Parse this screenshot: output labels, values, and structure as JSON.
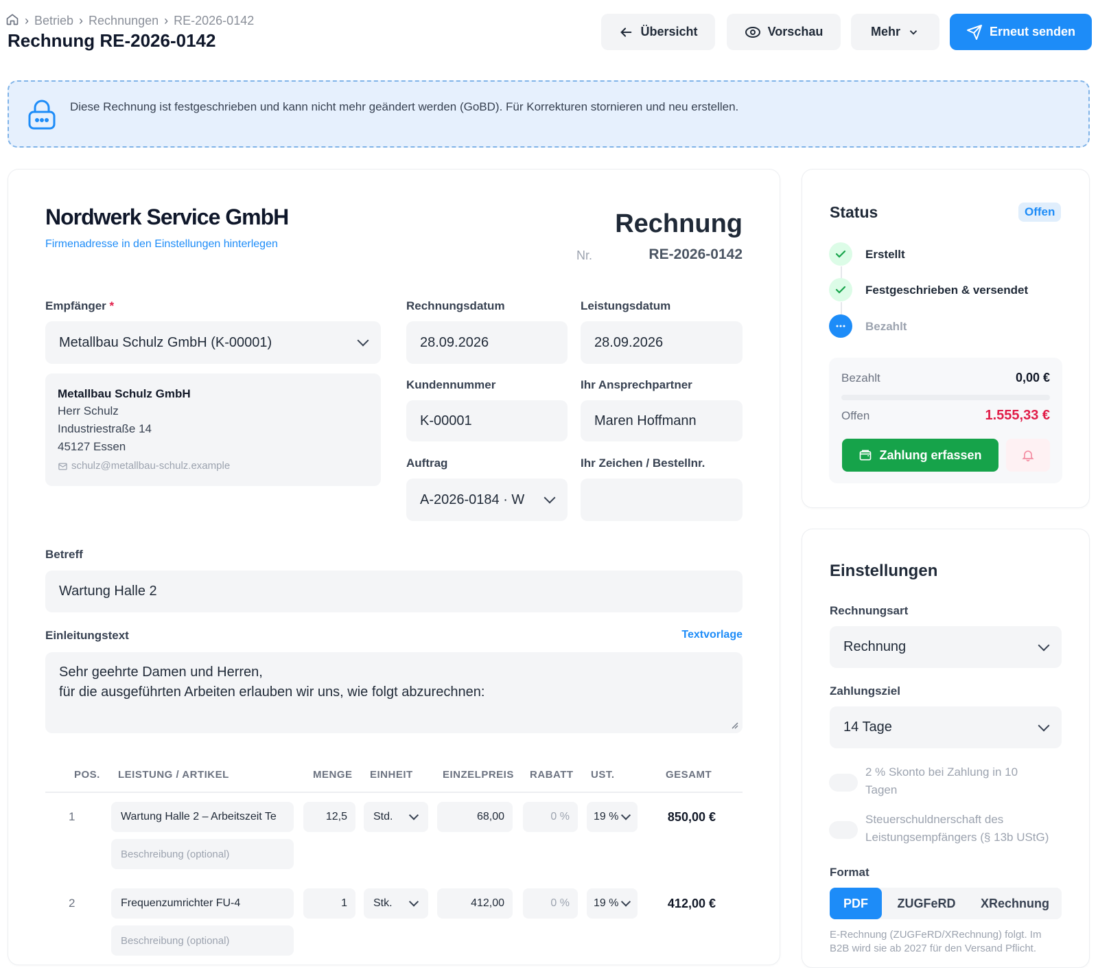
{
  "breadcrumb": {
    "items": [
      "Betrieb",
      "Rechnungen",
      "RE-2026-0142"
    ]
  },
  "page_title": "Rechnung RE-2026-0142",
  "toolbar": {
    "overview_label": "Übersicht",
    "preview_label": "Vorschau",
    "more_label": "Mehr",
    "resend_label": "Erneut senden"
  },
  "notice": {
    "text": "Diese Rechnung ist festgeschrieben und kann nicht mehr geändert werden (GoBD). Für Korrekturen stornieren und neu erstellen."
  },
  "doc": {
    "company": "Nordwerk Service GmbH",
    "company_link": "Firmenadresse in den Einstellungen hinterlegen",
    "doc_type": "Rechnung",
    "nr_label": "Nr.",
    "nr": "RE-2026-0142",
    "recipient_label": "Empfänger",
    "required": "*",
    "recipient": "Metallbau Schulz GmbH (K-00001)",
    "address": {
      "name": "Metallbau Schulz GmbH",
      "contact": "Herr Schulz",
      "street": "Industriestraße 14",
      "city": "45127 Essen",
      "email": "schulz@metallbau-schulz.example"
    },
    "invoice_date_label": "Rechnungsdatum",
    "invoice_date": "28.09.2026",
    "service_date_label": "Leistungsdatum",
    "service_date": "28.09.2026",
    "customer_no_label": "Kundennummer",
    "customer_no": "K-00001",
    "contact_label": "Ihr Ansprechpartner",
    "contact": "Maren Hoffmann",
    "order_label": "Auftrag",
    "order": "A-2026-0184 · W",
    "ref_label": "Ihr Zeichen / Bestellnr.",
    "ref": "",
    "subject_label": "Betreff",
    "subject": "Wartung Halle 2",
    "intro_label": "Einleitungstext",
    "intro_template": "Textvorlage",
    "intro_line1": "Sehr geehrte Damen und Herren,",
    "intro_line2": "für die ausgeführten Arbeiten erlauben wir uns, wie folgt abzurechnen:"
  },
  "table": {
    "headers": [
      "POS.",
      "LEISTUNG / ARTIKEL",
      "MENGE",
      "EINHEIT",
      "EINZELPREIS",
      "RABATT",
      "UST.",
      "GESAMT"
    ],
    "rows": [
      {
        "pos": "1",
        "item": "Wartung Halle 2 – Arbeitszeit Te",
        "desc": "Beschreibung (optional)",
        "qty": "12,5",
        "unit": "Std.",
        "price": "68,00",
        "discount": "0 %",
        "vat": "19 %",
        "total": "850,00 €"
      },
      {
        "pos": "2",
        "item": "Frequenzumrichter FU-4",
        "desc": "Beschreibung (optional)",
        "qty": "1",
        "unit": "Stk.",
        "price": "412,00",
        "discount": "0 %",
        "vat": "19 %",
        "total": "412,00 €"
      }
    ]
  },
  "status": {
    "title": "Status",
    "badge": "Offen",
    "steps": [
      "Erstellt",
      "Festgeschrieben & versendet",
      "Bezahlt"
    ],
    "paid_label": "Bezahlt",
    "paid_value": "0,00 €",
    "open_label": "Offen",
    "open_value": "1.555,33 €",
    "payment_button": "Zahlung erfassen",
    "paid_fraction": 0
  },
  "settings": {
    "title": "Einstellungen",
    "type_label": "Rechnungsart",
    "type_value": "Rechnung",
    "terms_label": "Zahlungsziel",
    "terms_value": "14 Tage",
    "skonto_line1": "2 % Skonto bei Zahlung in 10",
    "skonto_line2": "Tagen",
    "reverse_line1": "Steuerschuldnerschaft des",
    "reverse_line2": "Leistungsempfängers (§ 13b UStG)",
    "format_label": "Format",
    "formats": [
      "PDF",
      "ZUGFeRD",
      "XRechnung"
    ],
    "format_note_line1": "E-Rechnung (ZUGFeRD/XRechnung) folgt. Im",
    "format_note_line2": "B2B wird sie ab 2027 für den Versand Pflicht."
  },
  "colors": {
    "primary": "#1d8cf8",
    "success": "#16a34a",
    "danger": "#e11d48",
    "notice_bg": "#e6f0fd"
  }
}
